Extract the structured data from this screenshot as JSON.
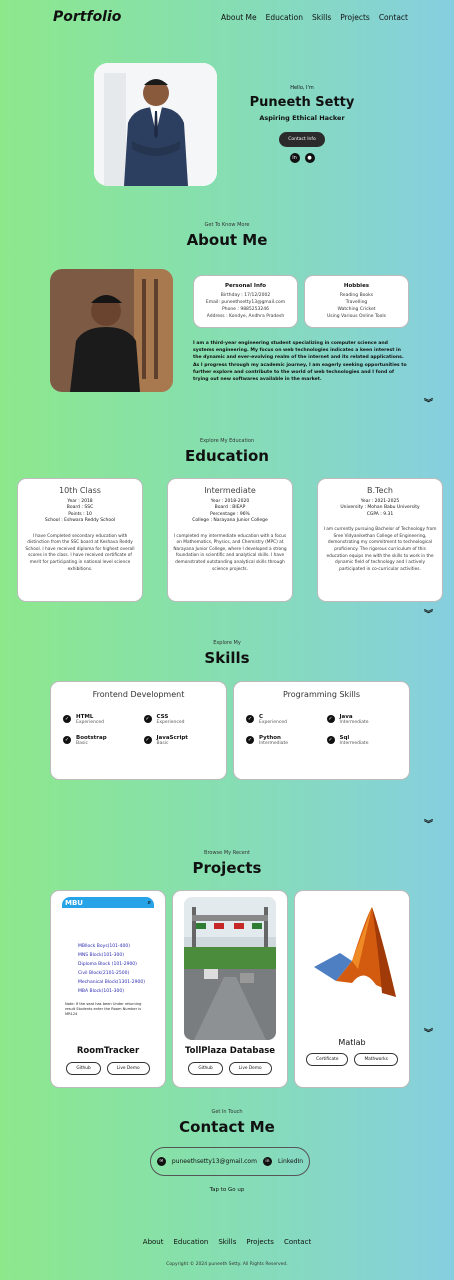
{
  "header": {
    "logo": "Portfolio",
    "nav": [
      "About Me",
      "Education",
      "Skills",
      "Projects",
      "Contact"
    ]
  },
  "hero": {
    "greeting": "Hello, I'm",
    "name": "Puneeth Setty",
    "tagline": "Aspiring Ethical Hacker",
    "cta": "Contact Info",
    "social": [
      "linkedin-icon",
      "github-icon"
    ]
  },
  "about": {
    "subtitle": "Get To Know More",
    "title": "About Me",
    "personal": {
      "heading": "Personal Info",
      "lines": [
        "Birthday : 17/12/2002",
        "Email: puneethsetty13@gmail.com",
        "Phone : 9885253246",
        "Address : Kondye, Andhra Pradesh"
      ]
    },
    "hobbies": {
      "heading": "Hobbies",
      "lines": [
        "Reading Books",
        "Travelling",
        "Watching Cricket",
        "Using Various Online Tools"
      ]
    },
    "paragraph": "I am a third-year engineering student specializing in computer science and systems engineering. My focus on web technologies indicates a keen interest in the dynamic and ever-evolving realm of the internet and its related applications. As I progress through my academic journey, I am eagerly seeking opportunities to further explore and contribute to the world of web technologies and I fond of trying out new softwares available in the market."
  },
  "education": {
    "subtitle": "Explore My Education",
    "title": "Education",
    "cards": [
      {
        "title": "10th Class",
        "lines": [
          "Year : 2018",
          "Board : SSC",
          "Points : 10",
          "School : Eshwara Reddy School"
        ],
        "desc": "I have Completed secondary education with distinction from the SSC board at Keshava Reddy School. I have received diploma for highest overall scores in the class. I have received certificate of merit for participating in national level science exhibitions."
      },
      {
        "title": "Intermediate",
        "lines": [
          "Year : 2018-2020",
          "Board : BIEAP",
          "Percentage : 96%",
          "College : Narayana Junior College"
        ],
        "desc": "I completed my intermediate education with a focus on Mathematics, Physics, and Chemistry (MPC) at Narayana Junior College, where I developed a strong foundation in scientific and analytical skills. I have demonstrated outstanding analytical skills through science projects."
      },
      {
        "title": "B.Tech",
        "lines": [
          "Year : 2021-2025",
          "University : Mohan Babu University",
          "CGPA : 9.31"
        ],
        "desc": "I am currently pursuing Bachelor of Technology from Sree Vidyanikethan College of Engineering, demonstrating my commitment to technological proficiency. The rigorous curriculum of this education equips me with the skills to work in the dynamic field of technology and I actively participated in co-curricular activities."
      }
    ]
  },
  "skills": {
    "subtitle": "Explore My",
    "title": "Skills",
    "groups": [
      {
        "title": "Frontend Development",
        "items": [
          {
            "name": "HTML",
            "level": "Experienced"
          },
          {
            "name": "CSS",
            "level": "Experienced"
          },
          {
            "name": "Bootstrap",
            "level": "Basic"
          },
          {
            "name": "JavaScript",
            "level": "Basic"
          }
        ]
      },
      {
        "title": "Programming Skills",
        "items": [
          {
            "name": "C",
            "level": "Experienced"
          },
          {
            "name": "Java",
            "level": "Intermediate"
          },
          {
            "name": "Python",
            "level": "Intermediate"
          },
          {
            "name": "Sql",
            "level": "Intermediate"
          }
        ]
      }
    ]
  },
  "projects": {
    "subtitle": "Browse My Recent",
    "title": "Projects",
    "items": [
      {
        "name": "RoomTracker",
        "buttons": [
          "Github",
          "Live Demo"
        ],
        "preview": {
          "brand": "MBU",
          "links": [
            "MBIlock Boys(101-400)",
            "MNS Block(101-300)",
            "Diploma Block (101-2900)",
            "Civil Block(2101-2500)",
            "Mechanical Block(1301-2900)",
            "MBA Block(101-300)"
          ],
          "note": "Note: If the seat has been Under returning result Students enter the Room Number is MR124"
        }
      },
      {
        "name": "TollPlaza Database",
        "buttons": [
          "Github",
          "Live Demo"
        ]
      },
      {
        "name": "Matlab",
        "buttons": [
          "Certificate",
          "Mathworks"
        ]
      }
    ]
  },
  "contact": {
    "subtitle": "Get In Touch",
    "title": "Contact Me",
    "email": "puneethsetty13@gmail.com",
    "linkedin": "LinkedIn",
    "top": "Tap to Go up"
  },
  "footer": {
    "nav": [
      "About",
      "Education",
      "Skills",
      "Projects",
      "Contact"
    ],
    "copyright": "Copyright © 2024 puneeth Setty. All Rights Reserved."
  }
}
